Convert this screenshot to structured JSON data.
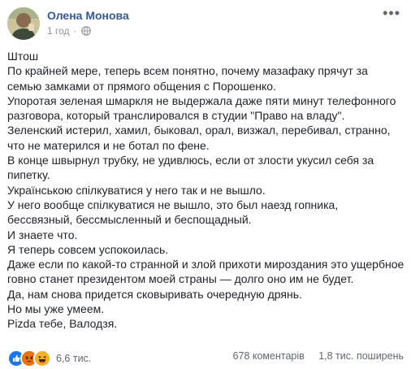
{
  "post": {
    "author": "Олена Монова",
    "time": "1 год",
    "dot": "·",
    "more_glyph": "•••",
    "paragraphs": [
      "Штош",
      "По крайней мере, теперь всем понятно, почему мазафаку прячут за семью замками от прямого общения с Порошенко.",
      "Упоротая зеленая шмаркля не выдержала даже пяти минут телефонного разговора, который транслировался в студии \"Право на владу\".",
      "Зеленский истерил, хамил, быковал, орал, визжал, перебивал, странно, что не матерился и не ботал по фене.",
      "В конце швырнул трубку, не удивлюсь, если от злости укусил себя за пипетку.",
      "Українською спілкуватися у него так и не вышло.",
      "У него вообще спілкуватися не вышло, это был наезд гопника, бессвязный, бессмысленный и беспощадный.",
      "И знаете что.",
      "Я теперь совсем успокоилась.",
      "Даже если по какой-то странной и злой прихоти мироздания это ущербное говно станет президентом моей страны — долго оно им не будет.",
      "Да, нам снова придется сковыривать очередную дрянь.",
      "Но мы уже умеем.",
      "Pizda тебе, Валодзя."
    ]
  },
  "footer": {
    "reactions_count": "6,6 тис.",
    "comments": "678 коментарів",
    "shares": "1,8 тис. поширень",
    "reactions": [
      "like-icon",
      "angry-icon",
      "haha-icon"
    ]
  },
  "colors": {
    "link": "#365899",
    "like": "#1877f2",
    "angry": "#e9710f",
    "haha": "#f7b125",
    "muted": "#90949c"
  }
}
